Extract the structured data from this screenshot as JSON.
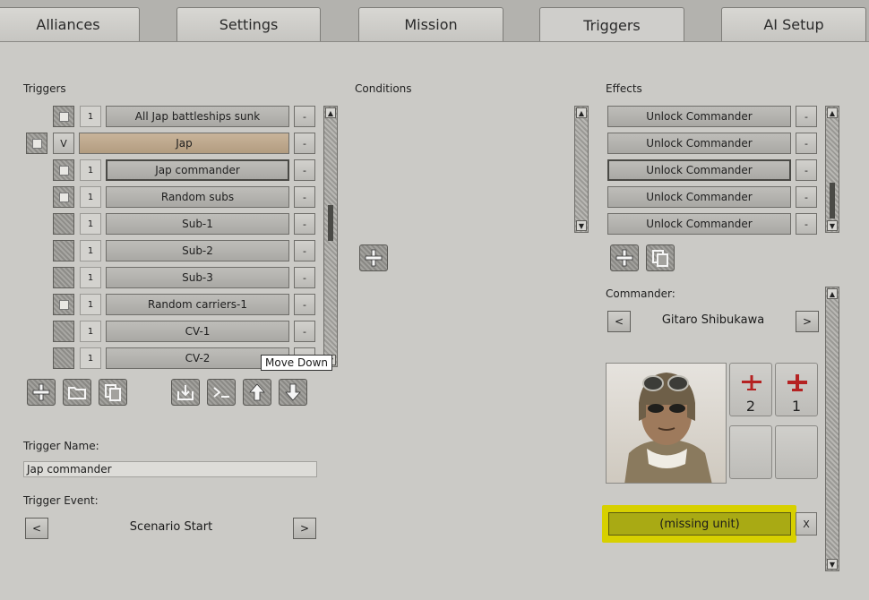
{
  "tabs": [
    {
      "label": "Alliances"
    },
    {
      "label": "Settings"
    },
    {
      "label": "Mission"
    },
    {
      "label": "Triggers"
    },
    {
      "label": "AI Setup"
    }
  ],
  "triggers": {
    "label": "Triggers",
    "items": [
      {
        "num": "1",
        "label": "All Jap battleships sunk",
        "minus": "-"
      },
      {
        "num": "V",
        "label": "Jap",
        "minus": "-"
      },
      {
        "num": "1",
        "label": "Jap commander",
        "minus": "-"
      },
      {
        "num": "1",
        "label": "Random subs",
        "minus": "-"
      },
      {
        "num": "1",
        "label": "Sub-1",
        "minus": "-"
      },
      {
        "num": "1",
        "label": "Sub-2",
        "minus": "-"
      },
      {
        "num": "1",
        "label": "Sub-3",
        "minus": "-"
      },
      {
        "num": "1",
        "label": "Random carriers-1",
        "minus": "-"
      },
      {
        "num": "1",
        "label": "CV-1",
        "minus": "-"
      },
      {
        "num": "1",
        "label": "CV-2",
        "minus": "-"
      }
    ],
    "tooltip": "Move Down"
  },
  "conditions": {
    "label": "Conditions"
  },
  "effects": {
    "label": "Effects",
    "items": [
      {
        "label": "Unlock Commander",
        "minus": "-"
      },
      {
        "label": "Unlock Commander",
        "minus": "-"
      },
      {
        "label": "Unlock Commander",
        "minus": "-"
      },
      {
        "label": "Unlock Commander",
        "minus": "-"
      },
      {
        "label": "Unlock Commander",
        "minus": "-"
      }
    ]
  },
  "trigger_name": {
    "label": "Trigger Name:",
    "value": "Jap commander"
  },
  "trigger_event": {
    "label": "Trigger Event:",
    "value": "Scenario Start",
    "prev": "<",
    "next": ">"
  },
  "commander": {
    "label": "Commander:",
    "name": "Gitaro Shibukawa",
    "prev": "<",
    "next": ">",
    "slots": [
      {
        "count": "2"
      },
      {
        "count": "1"
      }
    ],
    "unit": "(missing unit)",
    "remove": "X"
  },
  "colors": {
    "highlight": "#d7d000",
    "jap_row": "#c2ac90"
  }
}
